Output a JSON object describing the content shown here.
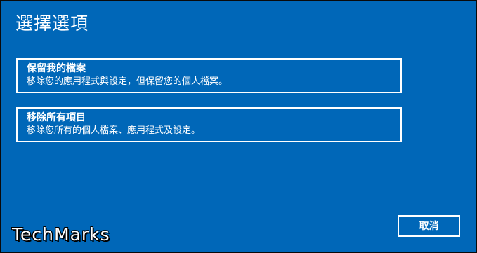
{
  "dialog": {
    "title": "選擇選項",
    "options": [
      {
        "title": "保留我的檔案",
        "description": "移除您的應用程式與設定，但保留您的個人檔案。"
      },
      {
        "title": "移除所有項目",
        "description": "移除您所有的個人檔案、應用程式及設定。"
      }
    ],
    "cancel_label": "取消"
  },
  "watermark": {
    "text": "TechMarks"
  },
  "colors": {
    "background": "#0067b8",
    "text": "#ffffff",
    "border": "#ffffff"
  }
}
